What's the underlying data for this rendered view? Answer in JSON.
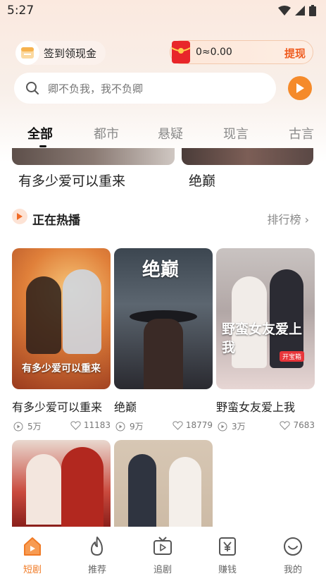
{
  "status": {
    "time": "5:27"
  },
  "checkin": {
    "label": "签到领现金"
  },
  "wallet": {
    "amount": "0≈0.00",
    "withdraw": "提现"
  },
  "search": {
    "placeholder": "卿不负我，我不负卿"
  },
  "tabs": [
    {
      "label": "全部",
      "active": true
    },
    {
      "label": "都市"
    },
    {
      "label": "悬疑"
    },
    {
      "label": "现言"
    },
    {
      "label": "古言"
    }
  ],
  "partial_row": [
    {
      "title": "有多少爱可以重来"
    },
    {
      "title": "绝巅"
    }
  ],
  "section": {
    "title": "正在热播",
    "more": "排行榜"
  },
  "cards": [
    {
      "title": "有多少爱可以重来",
      "plays": "5万",
      "likes": "11183",
      "poster_text": "有多少爱可以重来"
    },
    {
      "title": "绝巅",
      "plays": "9万",
      "likes": "18779",
      "poster_text": "绝巅"
    },
    {
      "title": "野蛮女友爱上我",
      "plays": "3万",
      "likes": "7683",
      "poster_text": "野蛮女友爱上我",
      "badge": "开宝箱"
    }
  ],
  "nav": [
    {
      "label": "短剧",
      "icon": "home-icon",
      "active": true
    },
    {
      "label": "推荐",
      "icon": "flame-icon"
    },
    {
      "label": "追剧",
      "icon": "tv-icon"
    },
    {
      "label": "赚钱",
      "icon": "yuan-icon"
    },
    {
      "label": "我的",
      "icon": "smile-icon"
    }
  ],
  "colors": {
    "accent": "#f07a25",
    "withdraw": "#ef5b1e",
    "play_button": "#f58a2a"
  }
}
